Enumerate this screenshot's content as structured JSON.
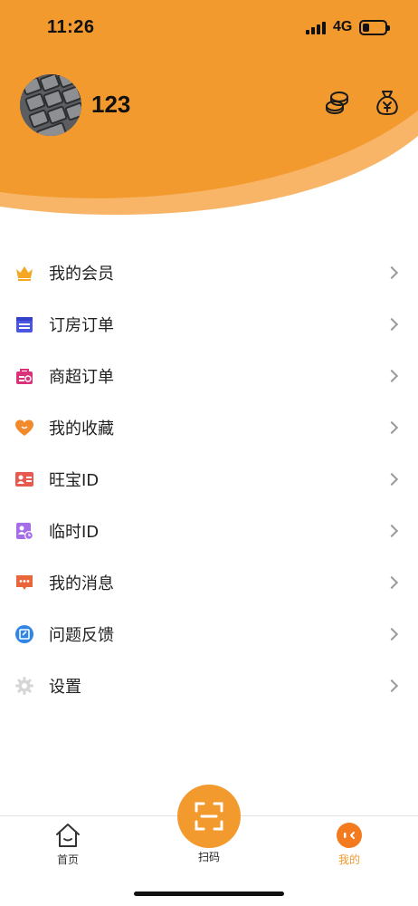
{
  "status_bar": {
    "time": "11:26",
    "network": "4G"
  },
  "profile": {
    "username": "123"
  },
  "colors": {
    "accent": "#f39a2e",
    "accent_light": "#f8b568",
    "background": "#ffffff"
  },
  "header_icons": [
    "coins-icon",
    "money-bag-icon"
  ],
  "menu": {
    "items": [
      {
        "label": "我的会员",
        "icon": "crown-icon"
      },
      {
        "label": "订房订单",
        "icon": "calendar-icon"
      },
      {
        "label": "商超订单",
        "icon": "shopping-bag-icon"
      },
      {
        "label": "我的收藏",
        "icon": "heart-icon"
      },
      {
        "label": "旺宝ID",
        "icon": "id-card-icon"
      },
      {
        "label": "临时ID",
        "icon": "temp-id-icon"
      },
      {
        "label": "我的消息",
        "icon": "message-icon"
      },
      {
        "label": "问题反馈",
        "icon": "feedback-icon"
      },
      {
        "label": "设置",
        "icon": "gear-icon"
      }
    ]
  },
  "tabbar": {
    "home_label": "首页",
    "scan_label": "扫码",
    "mine_label": "我的"
  }
}
